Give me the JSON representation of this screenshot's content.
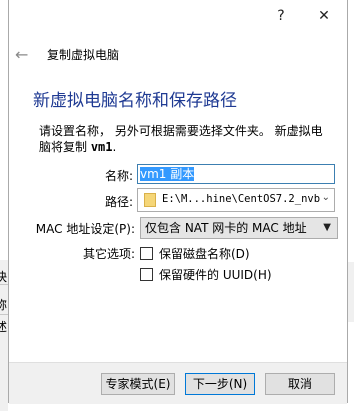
{
  "titlebar": {
    "help_icon": "?",
    "close_icon": "✕"
  },
  "back": {
    "arrow": "←",
    "label": "复制虚拟电脑"
  },
  "heading": "新虚拟电脑名称和保存路径",
  "description": {
    "line1": "请设置名称， 另外可根据需要选择文件夹。 新虚拟电",
    "line2_prefix": "脑将复制 ",
    "line2_vm": "vm1",
    "line2_suffix": "."
  },
  "form": {
    "name_label": "名称:",
    "name_value": "vm1 副本",
    "path_label": "路径:",
    "path_value": "E:\\M...hine\\CentOS7.2_nvb",
    "mac_label": "MAC 地址设定(P):",
    "mac_value": "仅包含 NAT 网卡的 MAC 地址",
    "other_label": "其它选项:",
    "keep_disk_names": "保留磁盘名称(D)",
    "keep_hw_uuids": "保留硬件的 UUID(H)"
  },
  "buttons": {
    "expert": "专家模式(E)",
    "next": "下一步(N)",
    "cancel": "取消"
  },
  "background": {
    "char1": "快",
    "char2": "称",
    "char3": "述"
  }
}
